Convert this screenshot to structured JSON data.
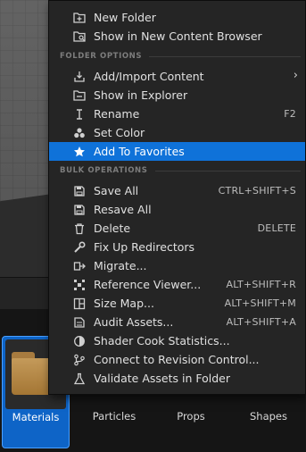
{
  "menu": {
    "items_top": [
      {
        "label": "New Folder",
        "icon": "new-folder-icon"
      },
      {
        "label": "Show in New Content Browser",
        "icon": "content-browser-icon"
      }
    ],
    "folder_options": {
      "header": "FOLDER OPTIONS",
      "items": [
        {
          "label": "Add/Import Content",
          "icon": "import-icon",
          "submenu": "›"
        },
        {
          "label": "Show in Explorer",
          "icon": "explorer-icon"
        },
        {
          "label": "Rename",
          "icon": "rename-icon",
          "shortcut": "F2"
        },
        {
          "label": "Set Color",
          "icon": "color-icon"
        },
        {
          "label": "Add To Favorites",
          "icon": "star-icon"
        }
      ]
    },
    "bulk_operations": {
      "header": "BULK OPERATIONS",
      "items": [
        {
          "label": "Save All",
          "icon": "save-icon",
          "shortcut": "CTRL+SHIFT+S"
        },
        {
          "label": "Resave All",
          "icon": "save-icon"
        },
        {
          "label": "Delete",
          "icon": "trash-icon",
          "shortcut": "DELETE"
        },
        {
          "label": "Fix Up Redirectors",
          "icon": "wrench-icon"
        },
        {
          "label": "Migrate...",
          "icon": "migrate-icon"
        },
        {
          "label": "Reference Viewer...",
          "icon": "reference-viewer-icon",
          "shortcut": "ALT+SHIFT+R"
        },
        {
          "label": "Size Map...",
          "icon": "size-map-icon",
          "shortcut": "ALT+SHIFT+M"
        },
        {
          "label": "Audit Assets...",
          "icon": "audit-icon",
          "shortcut": "ALT+SHIFT+A"
        },
        {
          "label": "Shader Cook Statistics...",
          "icon": "shader-stats-icon"
        },
        {
          "label": "Connect to Revision Control...",
          "icon": "revision-control-icon"
        },
        {
          "label": "Validate Assets in Folder",
          "icon": "validate-icon"
        }
      ]
    }
  },
  "content_browser": {
    "folders": [
      {
        "label": "Materials",
        "selected": true
      },
      {
        "label": "Particles"
      },
      {
        "label": "Props"
      },
      {
        "label": "Shapes"
      }
    ]
  },
  "colors": {
    "menu_bg": "#252525",
    "highlight": "#0f72d9",
    "selected_tile": "#0e64c7",
    "folder": "#b5874a"
  }
}
